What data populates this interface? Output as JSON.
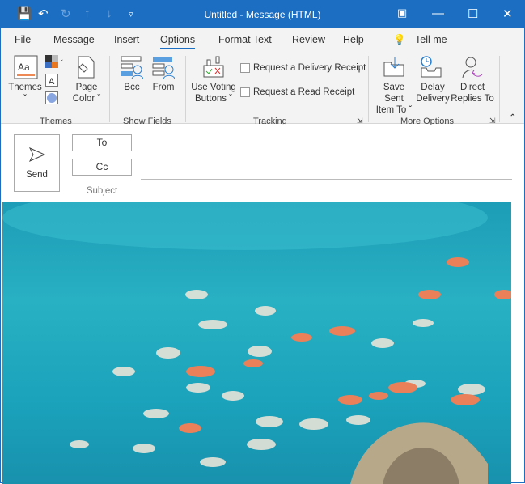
{
  "window": {
    "title": "Untitled  -  Message (HTML)"
  },
  "tabs": [
    "File",
    "Message",
    "Insert",
    "Options",
    "Format Text",
    "Review",
    "Help"
  ],
  "tell_me": "Tell me",
  "ribbon": {
    "themes": {
      "themes_label": "Themes",
      "page_color_1": "Page",
      "page_color_2": "Color",
      "group": "Themes"
    },
    "show_fields": {
      "bcc": "Bcc",
      "from": "From",
      "group": "Show Fields"
    },
    "tracking": {
      "voting_1": "Use Voting",
      "voting_2": "Buttons",
      "delivery_receipt": "Request a Delivery Receipt",
      "read_receipt": "Request a Read Receipt",
      "group": "Tracking"
    },
    "more_options": {
      "save_sent_1": "Save Sent",
      "save_sent_2": "Item To",
      "delay_1": "Delay",
      "delay_2": "Delivery",
      "direct_1": "Direct",
      "direct_2": "Replies To",
      "group": "More Options"
    }
  },
  "compose": {
    "send": "Send",
    "to": "To",
    "cc": "Cc",
    "subject": "Subject"
  },
  "colors": {
    "accent": "#1b6ec2"
  }
}
